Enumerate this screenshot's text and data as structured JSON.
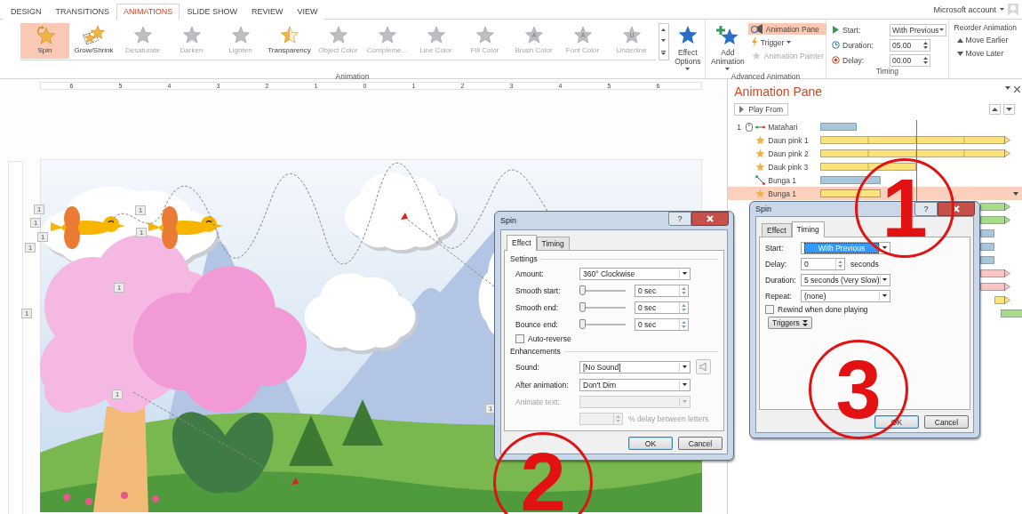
{
  "tabs": [
    {
      "label": "DESIGN",
      "selected": false
    },
    {
      "label": "TRANSITIONS",
      "selected": false
    },
    {
      "label": "ANIMATIONS",
      "selected": true
    },
    {
      "label": "SLIDE SHOW",
      "selected": false
    },
    {
      "label": "REVIEW",
      "selected": false
    },
    {
      "label": "VIEW",
      "selected": false
    }
  ],
  "account": "Microsoft account",
  "ribbon": {
    "gallery": [
      {
        "label": "Spin",
        "kind": "spin",
        "selected": true,
        "disabled": false
      },
      {
        "label": "Grow/Shrink",
        "kind": "grow",
        "selected": false,
        "disabled": false
      },
      {
        "label": "Desaturate",
        "kind": "star",
        "selected": false,
        "disabled": true
      },
      {
        "label": "Darken",
        "kind": "star",
        "selected": false,
        "disabled": true
      },
      {
        "label": "Lighten",
        "kind": "star",
        "selected": false,
        "disabled": true
      },
      {
        "label": "Transparency",
        "kind": "half",
        "selected": false,
        "disabled": false
      },
      {
        "label": "Object Color",
        "kind": "star",
        "selected": false,
        "disabled": true
      },
      {
        "label": "Compleme...",
        "kind": "star",
        "selected": false,
        "disabled": true
      },
      {
        "label": "Line Color",
        "kind": "star",
        "selected": false,
        "disabled": true
      },
      {
        "label": "Fill Color",
        "kind": "star",
        "selected": false,
        "disabled": true
      },
      {
        "label": "Brush Color",
        "kind": "letter",
        "glyph": "A",
        "selected": false,
        "disabled": true
      },
      {
        "label": "Font Color",
        "kind": "letter",
        "glyph": "A",
        "selected": false,
        "disabled": true
      },
      {
        "label": "Underline",
        "kind": "letter",
        "glyph": "U",
        "selected": false,
        "disabled": true
      }
    ],
    "effect_options": "Effect Options",
    "animation_group": "Animation",
    "add_animation": "Add Animation",
    "animation_pane": {
      "label": "Animation Pane",
      "selected": true
    },
    "trigger": "Trigger",
    "animation_painter": {
      "label": "Animation Painter",
      "disabled": true
    },
    "advanced_group": "Advanced Animation",
    "timing": {
      "start_label": "Start:",
      "start_value": "With Previous",
      "duration_label": "Duration:",
      "duration_value": "05.00",
      "delay_label": "Delay:",
      "delay_value": "00.00"
    },
    "timing_group": "Timing",
    "reorder": {
      "title": "Reorder Animation",
      "earlier": "Move Earlier",
      "later": "Move Later"
    }
  },
  "ruler": [
    "6",
    "5",
    "4",
    "3",
    "2",
    "1",
    "0",
    "1",
    "2",
    "3",
    "4",
    "5",
    "6"
  ],
  "slide": {
    "tags": [
      "1",
      "1",
      "1",
      "1",
      "1",
      "1",
      "1",
      "1",
      "1",
      "1"
    ]
  },
  "pane": {
    "title": "Animation Pane",
    "play_from": "Play From",
    "items": [
      {
        "number": "1",
        "name": "Matahari",
        "kind": "line-path",
        "color": "#a6c7dc",
        "selected": false
      },
      {
        "name": "Daun pink 1",
        "kind": "emphasis",
        "color": "#fbe27a",
        "selected": false
      },
      {
        "name": "Daun pink 2",
        "kind": "emphasis",
        "color": "#fbe27a",
        "selected": false
      },
      {
        "name": "Dauk pink 3",
        "kind": "emphasis",
        "color": "#fbe27a",
        "selected": false
      },
      {
        "name": "Bunga 1",
        "kind": "motion",
        "color": "#a6c7dc",
        "selected": false
      },
      {
        "name": "Bunga 1",
        "kind": "emphasis",
        "color": "#fbe27a",
        "selected": true
      },
      {
        "kind": "hidden",
        "color": "#a6dc8a",
        "selected": false
      },
      {
        "kind": "hidden",
        "color": "#a6dc8a",
        "selected": false
      },
      {
        "kind": "hidden",
        "color": "#a6c7dc",
        "selected": false
      },
      {
        "kind": "hidden",
        "color": "#a6c7dc",
        "selected": false
      },
      {
        "kind": "hidden",
        "color": "#a6c7dc",
        "selected": false
      },
      {
        "kind": "hidden",
        "color": "#f8c4c4",
        "selected": false
      },
      {
        "kind": "hidden",
        "color": "#f8c4c4",
        "selected": false
      },
      {
        "kind": "hidden",
        "color": "#fbe27a",
        "selected": false
      },
      {
        "kind": "hidden",
        "color": "#a6dc8a",
        "selected": false
      }
    ]
  },
  "effect_dialog": {
    "title": "Spin",
    "help": "?",
    "tabs": [
      {
        "label": "Effect",
        "selected": true
      },
      {
        "label": "Timing",
        "selected": false
      }
    ],
    "settings_heading": "Settings",
    "amount": {
      "label": "Amount:",
      "value": "360° Clockwise"
    },
    "sliders": [
      {
        "label": "Smooth start:",
        "level": 0,
        "value": "0 sec"
      },
      {
        "label": "Smooth end:",
        "level": 0,
        "value": "0 sec"
      },
      {
        "label": "Bounce end:",
        "level": 0,
        "value": "0 sec"
      }
    ],
    "auto_reverse": {
      "label": "Auto-reverse",
      "checked": false
    },
    "enhancements_heading": "Enhancements",
    "sound": {
      "label": "Sound:",
      "value": "[No Sound]"
    },
    "after_animation": {
      "label": "After animation:",
      "value": "Don't Dim"
    },
    "animate_text": {
      "label": "Animate text:",
      "disabled": true
    },
    "letter_delay": {
      "label": "% delay between letters",
      "disabled": true
    },
    "buttons": [
      "OK",
      "Cancel"
    ]
  },
  "timing_dialog": {
    "title": "Spin",
    "help": "?",
    "tabs": [
      {
        "label": "Effect",
        "selected": false
      },
      {
        "label": "Timing",
        "selected": true
      }
    ],
    "fields": [
      {
        "label": "Start:",
        "value": "With Previous",
        "kind": "dropdown",
        "focused": true
      },
      {
        "label": "Delay:",
        "value": "0",
        "unit": "seconds",
        "kind": "spin",
        "focused": false
      },
      {
        "label": "Duration:",
        "value": "5 seconds (Very Slow)",
        "kind": "dropdown",
        "focused": false
      },
      {
        "label": "Repeat:",
        "value": "(none)",
        "kind": "dropdown",
        "focused": false
      }
    ],
    "rewind": {
      "label": "Rewind when done playing",
      "checked": false
    },
    "triggers": "Triggers",
    "buttons": [
      "OK",
      "Cancel"
    ]
  },
  "annotations": [
    "1",
    "2",
    "3"
  ]
}
